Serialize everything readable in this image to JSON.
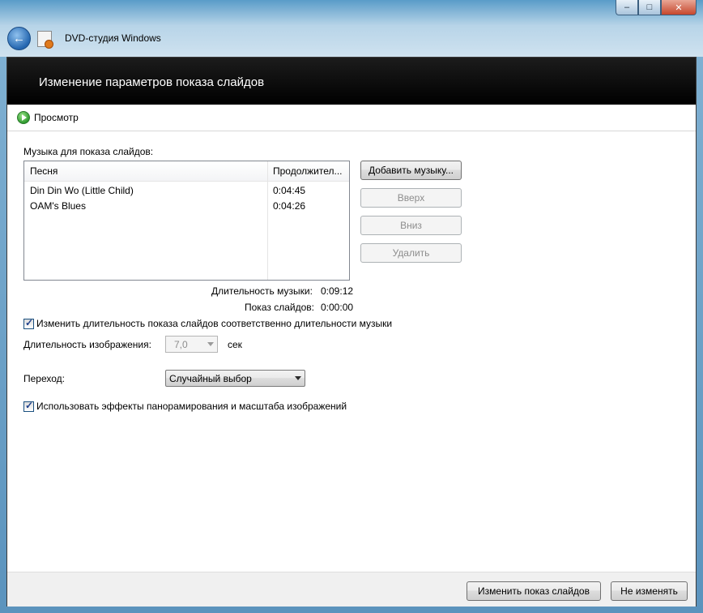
{
  "window": {
    "app_title": "DVD-студия Windows",
    "controls": {
      "minimize": "–",
      "maximize": "□",
      "close": "✕"
    }
  },
  "header": {
    "title": "Изменение параметров показа слайдов"
  },
  "toolbar": {
    "preview_label": "Просмотр"
  },
  "music": {
    "section_label": "Музыка для показа слайдов:",
    "columns": [
      "Песня",
      "Продолжител..."
    ],
    "rows": [
      {
        "song": "Din Din Wo (Little Child)",
        "duration": "0:04:45"
      },
      {
        "song": "OAM's Blues",
        "duration": "0:04:26"
      }
    ],
    "buttons": {
      "add": "Добавить музыку...",
      "up": "Вверх",
      "down": "Вниз",
      "delete": "Удалить"
    },
    "music_duration_label": "Длительность музыки:",
    "music_duration_value": "0:09:12",
    "slideshow_label": "Показ слайдов:",
    "slideshow_value": "0:00:00"
  },
  "options": {
    "fit_to_music_label": "Изменить длительность показа слайдов соответственно длительности музыки",
    "fit_to_music_checked": true,
    "image_duration_label": "Длительность изображения:",
    "image_duration_value": "7,0",
    "image_duration_unit": "сек",
    "transition_label": "Переход:",
    "transition_value": "Случайный выбор",
    "pan_zoom_label": "Использовать эффекты панорамирования и масштаба изображений",
    "pan_zoom_checked": true
  },
  "footer": {
    "apply": "Изменить показ слайдов",
    "cancel": "Не изменять"
  },
  "colors": {
    "header_bg": "#000000",
    "titlebar": "#b7d4e8",
    "check": "#1e3f8a"
  }
}
